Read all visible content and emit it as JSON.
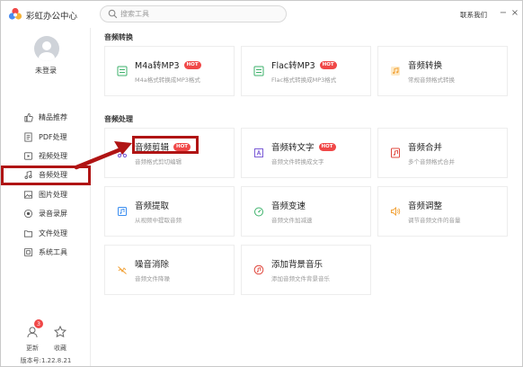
{
  "app": {
    "title": "彩虹办公中心"
  },
  "search": {
    "placeholder": "搜索工具"
  },
  "header": {
    "contact": "联系我们",
    "minimize": "−",
    "close": "×"
  },
  "user": {
    "login_label": "未登录"
  },
  "sidebar": {
    "items": [
      {
        "label": "精品推荐",
        "icon": "thumbs-up-icon"
      },
      {
        "label": "PDF处理",
        "icon": "pdf-icon"
      },
      {
        "label": "视频处理",
        "icon": "video-icon"
      },
      {
        "label": "音频处理",
        "icon": "music-icon",
        "active": true
      },
      {
        "label": "图片处理",
        "icon": "image-icon"
      },
      {
        "label": "录音录屏",
        "icon": "record-icon"
      },
      {
        "label": "文件处理",
        "icon": "folder-icon"
      },
      {
        "label": "系统工具",
        "icon": "system-icon"
      }
    ],
    "update_label": "更新",
    "update_badge": "3",
    "favorite_label": "收藏",
    "version": "版本号:1.22.8.21"
  },
  "sections": {
    "convert": {
      "title": "音频转换",
      "cards": [
        {
          "title": "M4a转MP3",
          "hot": "HOT",
          "desc": "M4a格式转换成MP3格式",
          "icon": "m4a-convert-icon"
        },
        {
          "title": "Flac转MP3",
          "hot": "HOT",
          "desc": "Flac格式转换成MP3格式",
          "icon": "flac-convert-icon"
        },
        {
          "title": "音频转换",
          "hot": "",
          "desc": "常规音频格式转换",
          "icon": "audio-convert-icon"
        }
      ]
    },
    "process": {
      "title": "音频处理",
      "cards": [
        {
          "title": "音频剪辑",
          "hot": "HOT",
          "desc": "音频格式剪切编辑",
          "icon": "audio-cut-icon"
        },
        {
          "title": "音频转文字",
          "hot": "HOT",
          "desc": "音频文件转换成文字",
          "icon": "audio-to-text-icon"
        },
        {
          "title": "音频合并",
          "hot": "",
          "desc": "多个音频格式合并",
          "icon": "audio-merge-icon"
        },
        {
          "title": "音频提取",
          "hot": "",
          "desc": "从视频中提取音频",
          "icon": "audio-extract-icon"
        },
        {
          "title": "音频变速",
          "hot": "",
          "desc": "音频文件加减速",
          "icon": "audio-speed-icon"
        },
        {
          "title": "音频调整",
          "hot": "",
          "desc": "调节音频文件的音量",
          "icon": "volume-adjust-icon"
        },
        {
          "title": "噪音消除",
          "hot": "",
          "desc": "音频文件降噪",
          "icon": "noise-remove-icon"
        },
        {
          "title": "添加背景音乐",
          "hot": "",
          "desc": "添加音频文件背景音乐",
          "icon": "add-bgm-icon"
        }
      ]
    }
  },
  "colors": {
    "accent": "#f04848",
    "annotation": "#b01414",
    "green": "#3db26b",
    "orange": "#f2a33a",
    "purple": "#7b5cd6",
    "blue": "#3a8df0",
    "red": "#e0483e"
  }
}
